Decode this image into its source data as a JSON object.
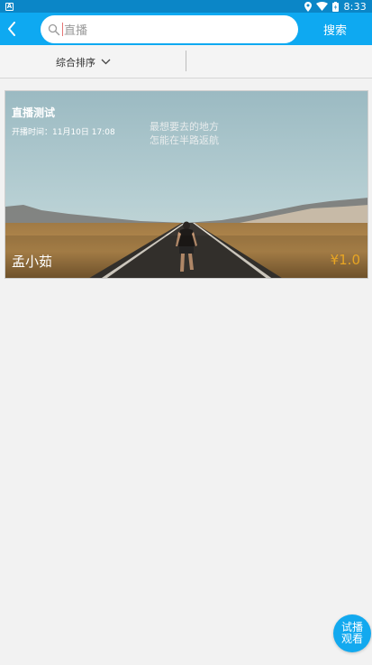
{
  "status_bar": {
    "time": "8:33",
    "icons": [
      "notification-icon",
      "location-icon",
      "wifi-icon",
      "battery-icon"
    ]
  },
  "header": {
    "back_icon": "back-arrow-icon",
    "search": {
      "value": "直播",
      "icon": "search-icon"
    },
    "search_button_label": "搜索"
  },
  "filter": {
    "sort_label": "综合排序",
    "sort_icon": "chevron-down-icon"
  },
  "card": {
    "title": "直播测试",
    "start_time": "开播时间：11月10日 17:08",
    "quote_line1": "最想要去的地方",
    "quote_line2": "怎能在半路返航",
    "author": "孟小茹",
    "price": "¥1.0"
  },
  "fab": {
    "line1": "试播",
    "line2": "观看"
  },
  "colors": {
    "status_bar": "#0b86c7",
    "header": "#0ea9f1",
    "price": "#e8a523",
    "background": "#f2f2f2"
  }
}
